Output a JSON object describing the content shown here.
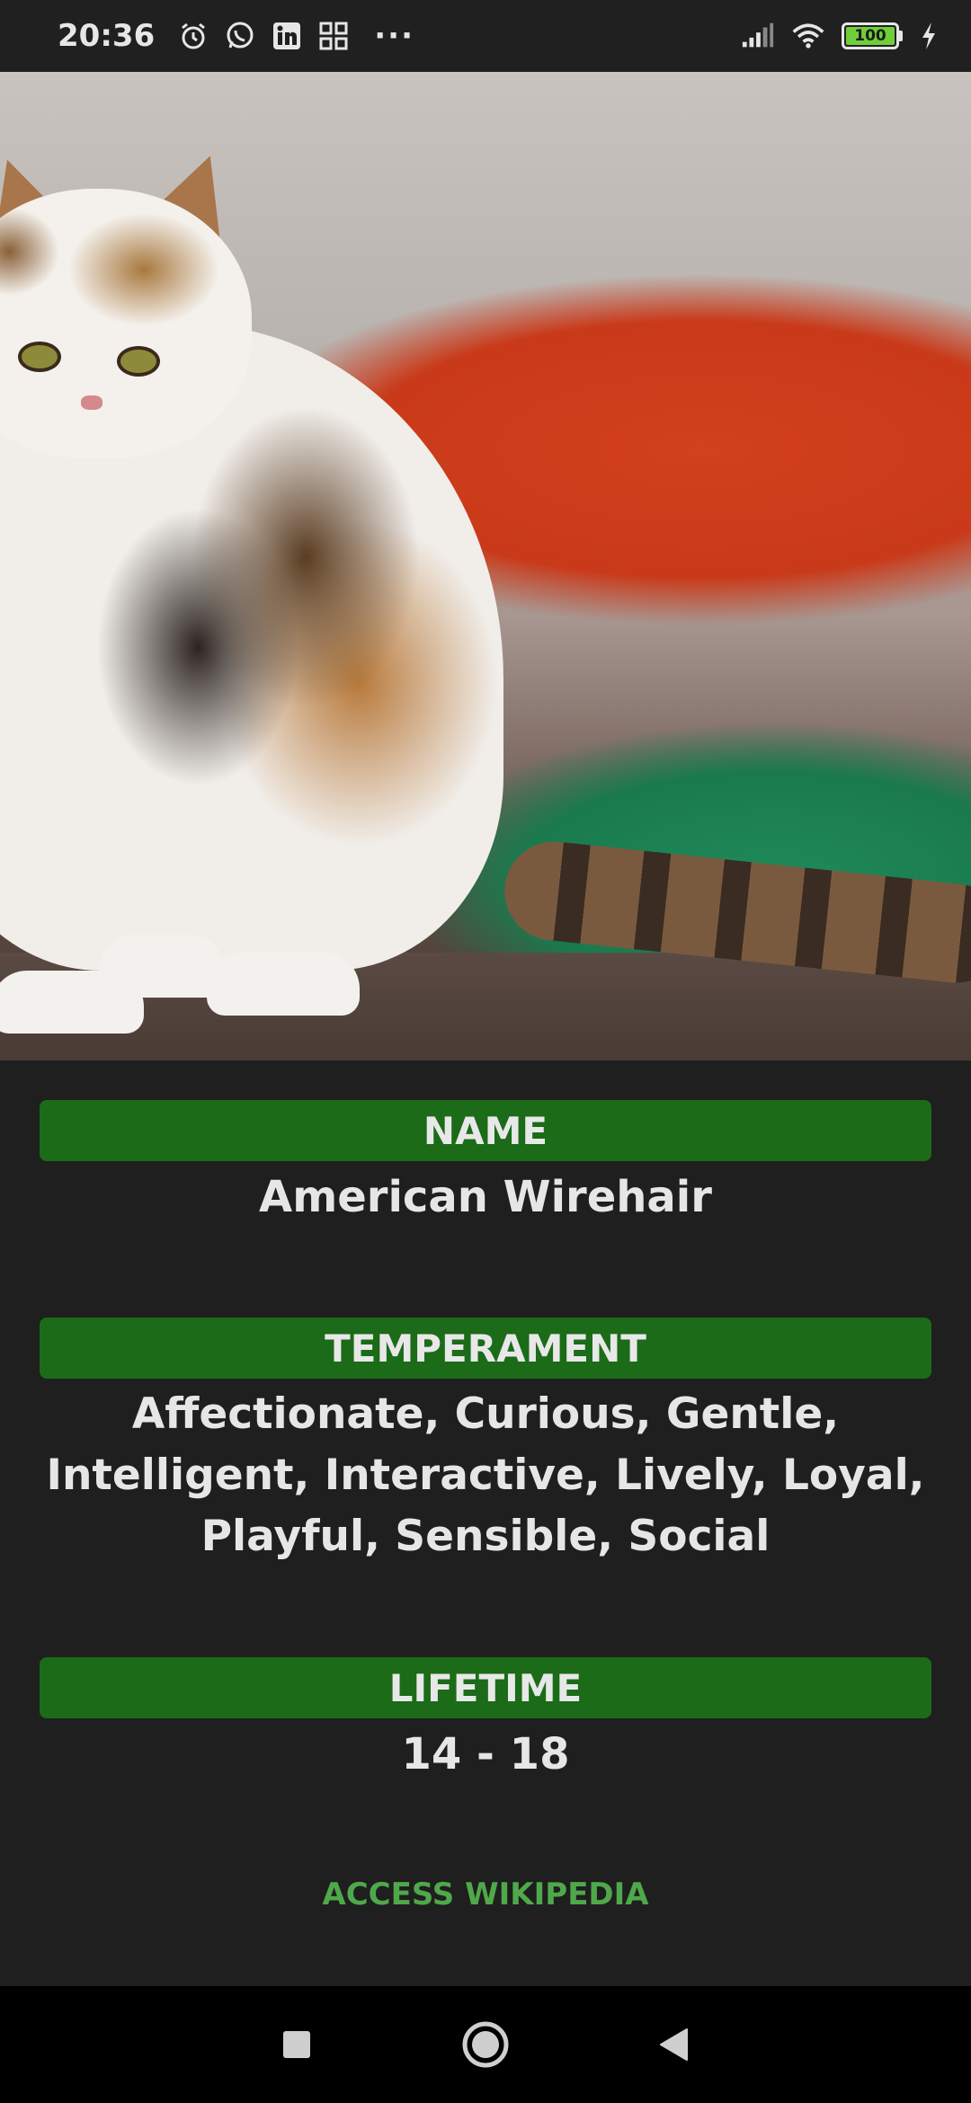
{
  "status_bar": {
    "time": "20:36",
    "left_icons": [
      "alarm-icon",
      "whatsapp-icon",
      "linkedin-icon",
      "app-grid-icon"
    ],
    "overflow": "···",
    "battery_level": "100",
    "right_icons": [
      "signal-icon",
      "wifi-icon",
      "battery-icon",
      "charging-icon"
    ]
  },
  "hero": {
    "subject": "cat-photo"
  },
  "details": {
    "name_label": "NAME",
    "name_value": "American Wirehair",
    "temperament_label": "TEMPERAMENT",
    "temperament_value": "Affectionate, Curious, Gentle, Intelligent, Interactive, Lively, Loyal, Playful, Sensible, Social",
    "lifetime_label": "LIFETIME",
    "lifetime_value": "14 - 18"
  },
  "actions": {
    "wiki_link": "ACCESS WIKIPEDIA"
  },
  "nav_bar": {
    "buttons": [
      "recents-button",
      "home-button",
      "back-button"
    ]
  },
  "colors": {
    "accent_green": "#1b6b18",
    "link_green": "#4fa84a",
    "background": "#1f1f1f"
  }
}
